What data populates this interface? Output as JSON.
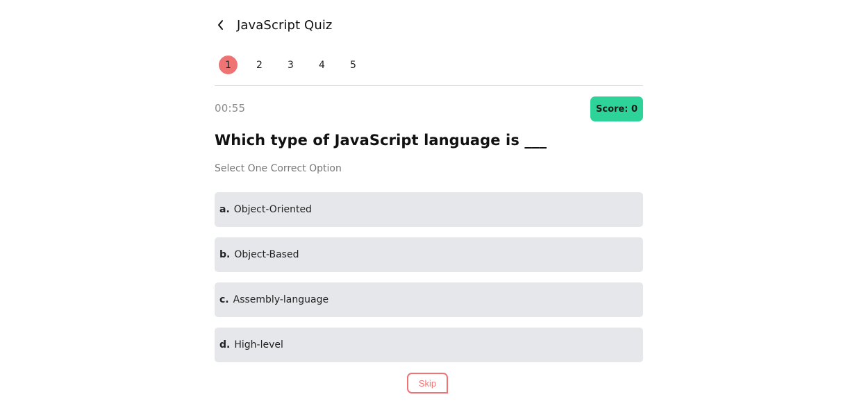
{
  "header": {
    "title": "JavaScript Quiz",
    "back_icon": "chevron-left-icon"
  },
  "steps": [
    {
      "label": "1",
      "active": true
    },
    {
      "label": "2",
      "active": false
    },
    {
      "label": "3",
      "active": false
    },
    {
      "label": "4",
      "active": false
    },
    {
      "label": "5",
      "active": false
    }
  ],
  "timer": "00:55",
  "score_label": "Score: 0",
  "question": "Which type of JavaScript language is ___",
  "instruction": "Select One Correct Option",
  "options": [
    {
      "letter": "a.",
      "text": "Object-Oriented"
    },
    {
      "letter": "b.",
      "text": "Object-Based"
    },
    {
      "letter": "c.",
      "text": "Assembly-language"
    },
    {
      "letter": "d.",
      "text": "High-level"
    }
  ],
  "skip_label": "Skip",
  "colors": {
    "active_step": "#f07373",
    "score_badge": "#2ed39a",
    "option_bg": "#e6e7ea",
    "skip_accent": "#f07373"
  }
}
